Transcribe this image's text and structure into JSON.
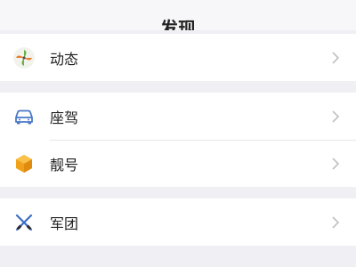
{
  "header": {
    "title": "发现"
  },
  "groups": [
    {
      "items": [
        {
          "label": "动态",
          "icon": "pinwheel-icon"
        }
      ]
    },
    {
      "items": [
        {
          "label": "座驾",
          "icon": "car-icon"
        },
        {
          "label": "靓号",
          "icon": "hexagon-badge-icon"
        }
      ]
    },
    {
      "items": [
        {
          "label": "军团",
          "icon": "crossed-rifles-icon"
        }
      ]
    }
  ],
  "colors": {
    "background": "#efeff4",
    "car_icon": "#4a79c7",
    "badge_icon": "#f0a21b",
    "pinwheel_green": "#6ab04c",
    "pinwheel_orange": "#e87d2b",
    "chevron": "#c0c0c4"
  }
}
